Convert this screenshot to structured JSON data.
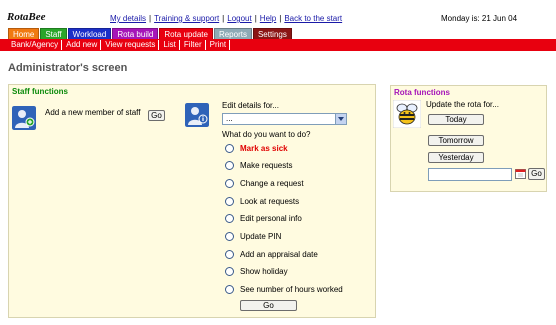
{
  "header": {
    "logo": "RotaBee",
    "links": [
      "My details",
      "Training & support",
      "Logout",
      "Help",
      "Back to the start"
    ],
    "date_text": "Monday is: 21 Jun 04"
  },
  "tabs": [
    {
      "label": "Home",
      "color": "#f07a12"
    },
    {
      "label": "Staff",
      "color": "#2aa52a"
    },
    {
      "label": "Workload",
      "color": "#1c2fc8"
    },
    {
      "label": "Rota build",
      "color": "#a515b8"
    },
    {
      "label": "Rota update",
      "color": "#e8000f"
    },
    {
      "label": "Reports",
      "color": "#8eaab6"
    },
    {
      "label": "Settings",
      "color": "#8a1515"
    }
  ],
  "subnav": [
    "Bank/Agency",
    "Add new",
    "View requests",
    "List",
    "Filter",
    "Print"
  ],
  "page_title": "Administrator's screen",
  "staff_panel": {
    "title": "Staff functions",
    "title_color": "#0a8a0a",
    "add_label": "Add a new member of staff",
    "add_button": "Go",
    "edit_label": "Edit details for...",
    "edit_select_value": "...",
    "question": "What do you want to do?",
    "options": [
      "Mark as sick",
      "Make requests",
      "Change a request",
      "Look at requests",
      "Edit personal info",
      "Update PIN",
      "Add an appraisal date",
      "Show holiday",
      "See number of hours worked"
    ],
    "go_button": "Go"
  },
  "rota_panel": {
    "title": "Rota functions",
    "title_color": "#a515b8",
    "update_label": "Update the rota for...",
    "today_button": "Today",
    "tomorrow_button": "Tomorrow",
    "yesterday_button": "Yesterday",
    "go_button": "Go"
  }
}
